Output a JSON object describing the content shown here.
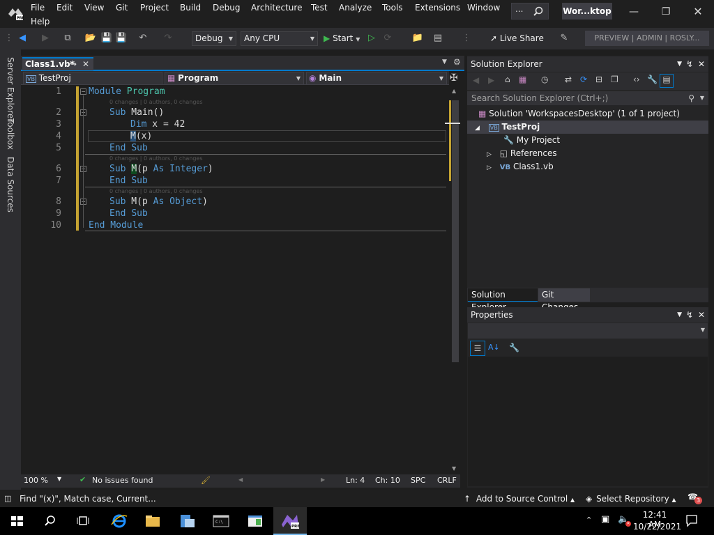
{
  "menu": [
    "File",
    "Edit",
    "View",
    "Git",
    "Project",
    "Build",
    "Debug",
    "Architecture",
    "Test",
    "Analyze",
    "Tools",
    "Extensions",
    "Window",
    "Help"
  ],
  "search_dots": "...",
  "solution_chip": "Wor...ktop",
  "toolbar": {
    "config": "Debug",
    "platform": "Any CPU",
    "start_label": "Start",
    "live_share": "Live Share",
    "preview_badge": "PREVIEW | ADMIN | ROSLY..."
  },
  "left_tabs": [
    "Server Explorer",
    "Toolbox",
    "Data Sources"
  ],
  "editor": {
    "tab_title": "Class1.vb*",
    "nav_project": "TestProj",
    "nav_type": "Program",
    "nav_member": "Main",
    "line_numbers": [
      "1",
      "2",
      "3",
      "4",
      "5",
      "6",
      "7",
      "8",
      "9",
      "10"
    ],
    "codelens": "0 changes | 0 authors, 0 changes",
    "zoom": "100 %",
    "issues": "No issues found",
    "ln": "Ln: 4",
    "ch": "Ch: 10",
    "spc": "SPC",
    "eol": "CRLF"
  },
  "solution_explorer": {
    "title": "Solution Explorer",
    "search_placeholder": "Search Solution Explorer (Ctrl+;)",
    "solution": "Solution 'WorkspacesDesktop' (1 of 1 project)",
    "project": "TestProj",
    "items": [
      "My Project",
      "References",
      "Class1.vb"
    ],
    "tab_active": "Solution Explorer",
    "tab_other": "Git Changes"
  },
  "properties": {
    "title": "Properties"
  },
  "statusbar": {
    "find": "Find \"(x)\", Match case, Current...",
    "source_control": "Add to Source Control",
    "repository": "Select Repository",
    "notifications": "3"
  },
  "taskbar": {
    "time": "12:41 AM",
    "date": "10/22/2021"
  },
  "colors": {
    "accent": "#007acc",
    "keyword": "#569cd6",
    "type": "#4ec9b0",
    "vs_purple": "#68217a"
  }
}
